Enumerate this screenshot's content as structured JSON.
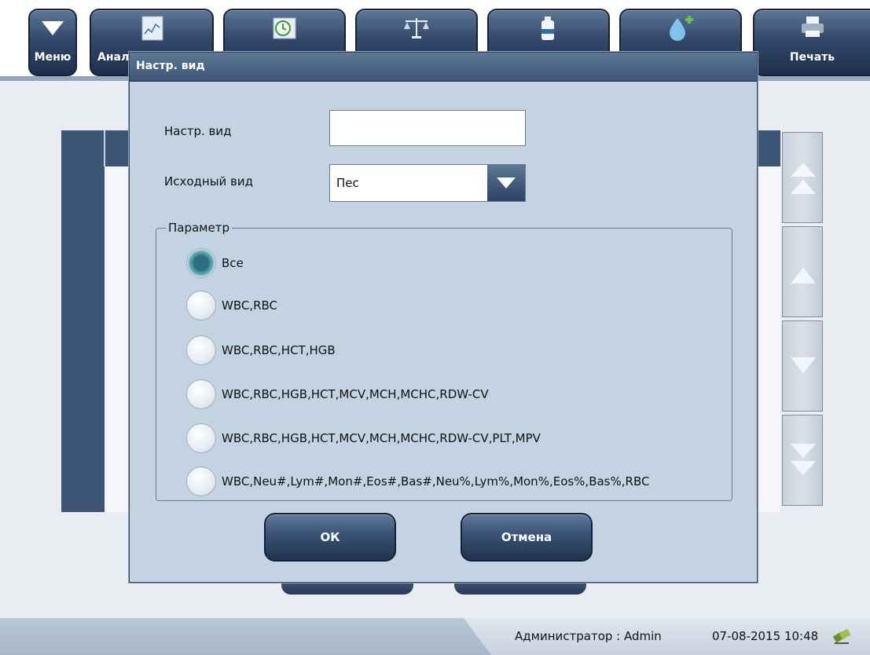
{
  "toolbar": {
    "menu_label": "Меню",
    "analysis_label": "Анал",
    "print_label": "Печать"
  },
  "dialog": {
    "title": "Настр. вид",
    "custom_view_label": "Настр. вид",
    "custom_view_value": "",
    "original_view_label": "Исходный вид",
    "original_view_value": "Пес",
    "param_group_label": "Параметр",
    "options": [
      {
        "label": "Все",
        "checked": true
      },
      {
        "label": "WBC,RBC",
        "checked": false
      },
      {
        "label": "WBC,RBC,HCT,HGB",
        "checked": false
      },
      {
        "label": "WBC,RBC,HGB,HCT,MCV,MCH,MCHC,RDW-CV",
        "checked": false
      },
      {
        "label": "WBC,RBC,HGB,HCT,MCV,MCH,MCHC,RDW-CV,PLT,MPV",
        "checked": false
      },
      {
        "label": "WBC,Neu#,Lym#,Mon#,Eos#,Bas#,Neu%,Lym%,Mon%,Eos%,Bas%,RBC",
        "checked": false
      }
    ],
    "ok_label": "ОК",
    "cancel_label": "Отмена"
  },
  "status": {
    "user": "Администратор : Admin",
    "datetime": "07-08-2015 10:48"
  },
  "colors": {
    "accent_dark": "#3d5574",
    "dialog_bg": "#c4d3e2"
  }
}
